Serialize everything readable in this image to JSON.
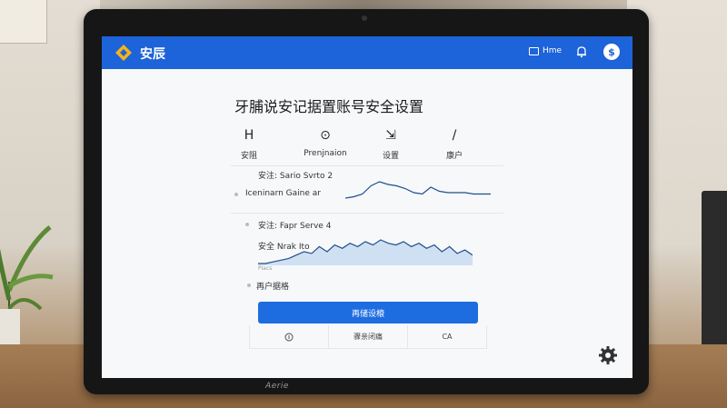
{
  "app": {
    "title": "安辰",
    "home_label": "Hme",
    "avatar_text": "",
    "brand_color": "#1d63d9"
  },
  "page_title": "牙脯说安记据置账号安全设置",
  "tabs": [
    {
      "icon": "H",
      "label": "安阻"
    },
    {
      "icon": "⊙",
      "label": "Prenjnaion"
    },
    {
      "icon": "⇲",
      "label": "设置"
    },
    {
      "icon": "/",
      "label": "康户"
    }
  ],
  "cards": [
    {
      "title": "安注: Sario Svrto 2",
      "subtitle": "Iceninarn Gaine ar",
      "caption": ""
    },
    {
      "title": "安注: Fapr Serve 4",
      "subtitle": "安全 Nrak Ito",
      "caption": "Piacs"
    }
  ],
  "section_label": "再户据格",
  "primary_button": "再储设榱",
  "segments": [
    "",
    "骤亲闭痛",
    "CA"
  ],
  "laptop_brand": "Aerie",
  "chart_data": [
    {
      "type": "line",
      "title": "",
      "series": [
        {
          "values": [
            0,
            1,
            3,
            9,
            12,
            10,
            9,
            7,
            4,
            3,
            8,
            5,
            4,
            4,
            4,
            3,
            3,
            3
          ]
        }
      ]
    },
    {
      "type": "area",
      "title": "",
      "series": [
        {
          "values": [
            2,
            2,
            3,
            4,
            5,
            7,
            9,
            8,
            12,
            9,
            13,
            11,
            14,
            12,
            15,
            13,
            16,
            14,
            13,
            15,
            12,
            14,
            11,
            13,
            9,
            12,
            8,
            10,
            7
          ]
        }
      ]
    }
  ]
}
